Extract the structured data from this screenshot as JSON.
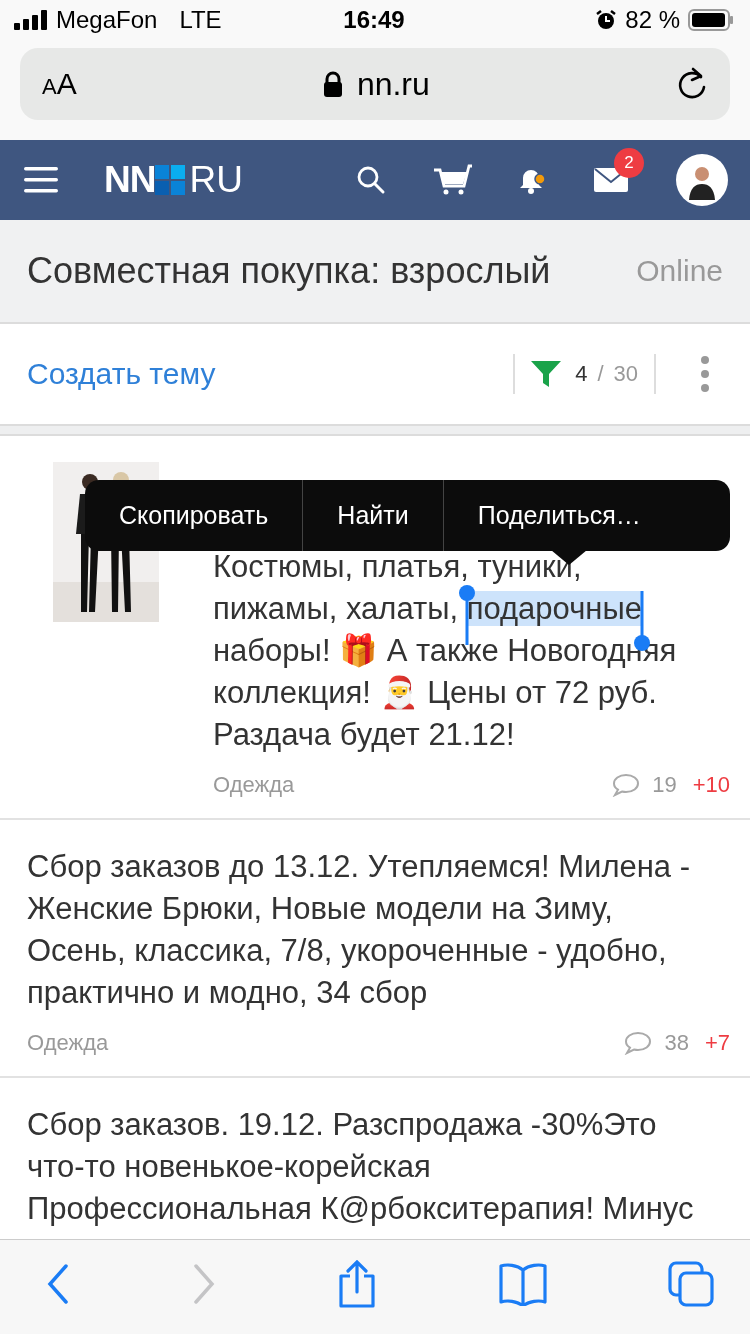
{
  "status_bar": {
    "carrier": "MegaFon",
    "network": "LTE",
    "time": "16:49",
    "battery": "82 %"
  },
  "address_bar": {
    "text_size": {
      "small": "A",
      "large": "A"
    },
    "url": "nn.ru"
  },
  "site_header": {
    "logo": {
      "left": "NN",
      "right": "RU"
    },
    "notifications_unread": true,
    "messages_badge": "2"
  },
  "forum": {
    "title": "Совместная покупка: взрослый",
    "status": "Online",
    "create_topic": "Создать тему",
    "page": "4",
    "separator": "/",
    "pages": "30"
  },
  "posts": [
    {
      "kind": "with_image",
      "body": [
        {
          "text": "Костюмы, платья, туники, пижамы, халаты, ",
          "selected": false
        },
        {
          "text": "подарочные",
          "selected": true
        },
        {
          "text": " наборы! 🎁 А также Новогодняя коллекция! 🎅 Цены от 72 руб. Раздача будет 21.12!",
          "selected": false
        }
      ],
      "category": "Одежда",
      "comments": "19",
      "rating": "+10"
    },
    {
      "kind": "text",
      "body": [
        {
          "text": "Сбор заказов до 13.12. Утепляемся! Милена - Женские Брюки, Новые модели на Зиму, Осень, классика, 7/8, укороченные - удобно, практично и модно, 34 сбор",
          "selected": false
        }
      ],
      "category": "Одежда",
      "comments": "38",
      "rating": "+7"
    },
    {
      "kind": "text",
      "body": [
        {
          "text": "Сбор заказов. 19.12. Разспродажа -30%Это что-то новенькое-корейская Профессиональная К@рбокситерапия! Минус",
          "selected": false
        }
      ]
    }
  ],
  "context_menu": {
    "items": [
      "Скопировать",
      "Найти",
      "Поделиться…"
    ]
  },
  "browser_toolbar": {
    "forward_disabled": true
  }
}
